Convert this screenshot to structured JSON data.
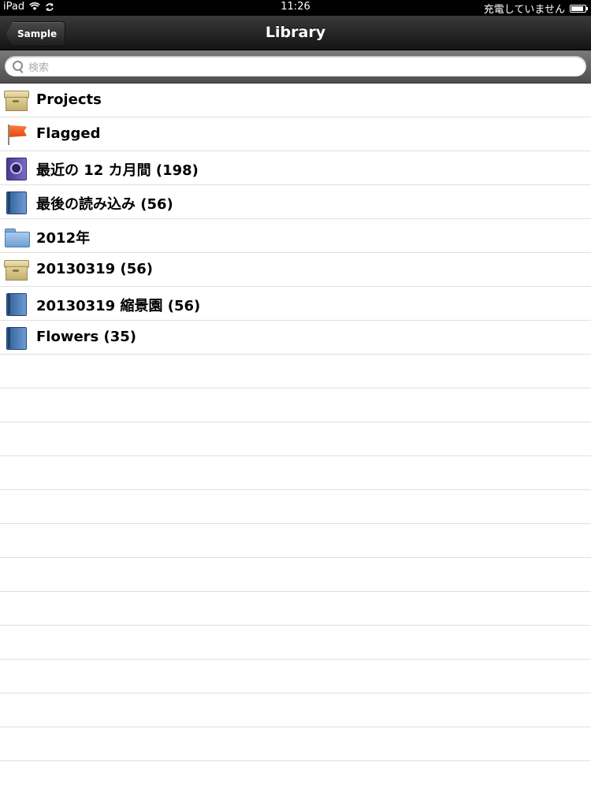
{
  "status_bar": {
    "device": "iPad",
    "time": "11:26",
    "charging_text": "充電していません"
  },
  "nav": {
    "title": "Library",
    "back_label": "Sample"
  },
  "search": {
    "placeholder": "検索",
    "value": ""
  },
  "list": {
    "items": [
      {
        "label": "Projects",
        "icon": "box-icon"
      },
      {
        "label": "Flagged",
        "icon": "flag-icon"
      },
      {
        "label": "最近の 12 カ月間 (198)",
        "icon": "smart-album-icon"
      },
      {
        "label": "最後の読み込み (56)",
        "icon": "album-icon"
      },
      {
        "label": "2012年",
        "icon": "folder-icon"
      },
      {
        "label": "20130319 (56)",
        "icon": "box-icon"
      },
      {
        "label": "20130319 縮景園 (56)",
        "icon": "album-icon"
      },
      {
        "label": "Flowers (35)",
        "icon": "album-icon"
      }
    ]
  }
}
